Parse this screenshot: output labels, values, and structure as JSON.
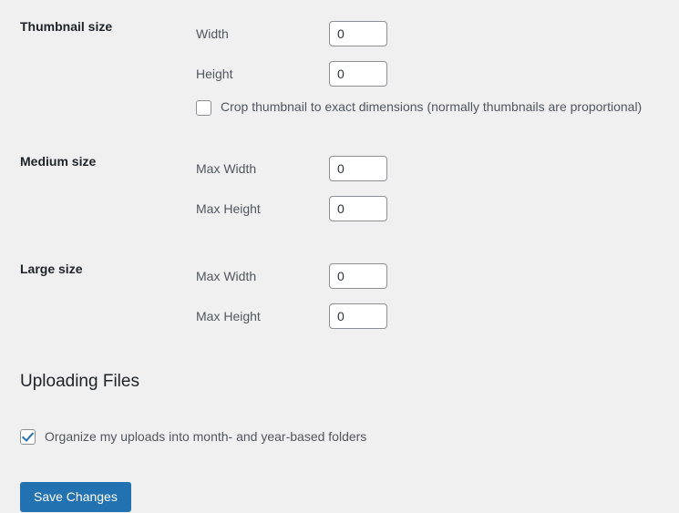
{
  "theme": {
    "background": "#f0f0f1",
    "accent": "#2271b1",
    "label_color": "#1d2327",
    "text_color": "#50575e",
    "input_border": "#8c8f94",
    "input_background": "#ffffff",
    "button_text": "#ffffff"
  },
  "sizes": [
    {
      "name": "thumbnail",
      "label": "Thumbnail size",
      "fields": [
        {
          "name": "thumbnail-width",
          "label": "Width",
          "value": "0"
        },
        {
          "name": "thumbnail-height",
          "label": "Height",
          "value": "0"
        }
      ],
      "crop": {
        "label": "Crop thumbnail to exact dimensions (normally thumbnails are proportional)",
        "checked": false
      }
    },
    {
      "name": "medium",
      "label": "Medium size",
      "fields": [
        {
          "name": "medium-max-width",
          "label": "Max Width",
          "value": "0"
        },
        {
          "name": "medium-max-height",
          "label": "Max Height",
          "value": "0"
        }
      ]
    },
    {
      "name": "large",
      "label": "Large size",
      "fields": [
        {
          "name": "large-max-width",
          "label": "Max Width",
          "value": "0"
        },
        {
          "name": "large-max-height",
          "label": "Max Height",
          "value": "0"
        }
      ]
    }
  ],
  "uploading": {
    "heading": "Uploading Files",
    "organize": {
      "label": "Organize my uploads into month- and year-based folders",
      "checked": true
    }
  },
  "submit": {
    "save_label": "Save Changes"
  }
}
